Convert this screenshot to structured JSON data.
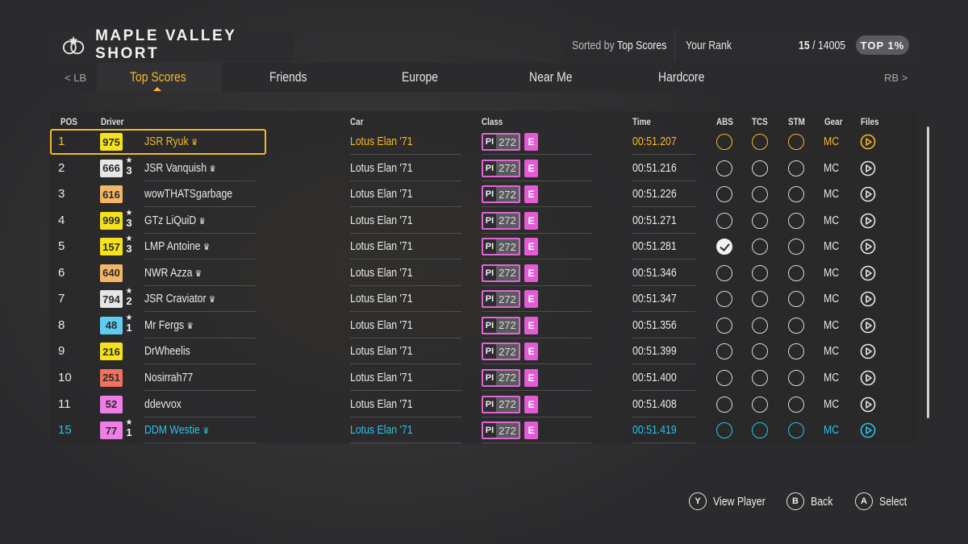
{
  "header": {
    "title": "MAPLE VALLEY SHORT",
    "sorted_prefix": "Sorted by",
    "sorted_value": "Top Scores",
    "your_rank_label": "Your Rank",
    "rank": "15",
    "rank_total": "/ 14005",
    "top_badge": "TOP 1%"
  },
  "tabs": {
    "lb": "< LB",
    "rb": "RB >",
    "items": [
      "Top Scores",
      "Friends",
      "Europe",
      "Near Me",
      "Hardcore"
    ],
    "active": "Top Scores"
  },
  "columns": {
    "pos": "POS",
    "driver": "Driver",
    "car": "Car",
    "class": "Class",
    "time": "Time",
    "abs": "ABS",
    "tcs": "TCS",
    "stm": "STM",
    "gear": "Gear",
    "files": "Files"
  },
  "colors": {
    "selected": "#f5b82c",
    "player": "#29c2e8",
    "class_e": "#e35cd6"
  },
  "rows": [
    {
      "pos": "1",
      "level": "975",
      "level_color": "#f6e21c",
      "stars": "",
      "driver": "JSR Ryuk",
      "crown": true,
      "car": "Lotus Elan '71",
      "pi_label": "PI",
      "pi": "272",
      "cls": "E",
      "time": "00:51.207",
      "abs": false,
      "tcs": false,
      "stm": false,
      "gear": "MC",
      "state": "selected"
    },
    {
      "pos": "2",
      "level": "666",
      "level_color": "#e6e6e6",
      "stars": "3",
      "driver": "JSR Vanquish",
      "crown": true,
      "car": "Lotus Elan '71",
      "pi_label": "PI",
      "pi": "272",
      "cls": "E",
      "time": "00:51.216",
      "abs": false,
      "tcs": false,
      "stm": false,
      "gear": "MC",
      "state": ""
    },
    {
      "pos": "3",
      "level": "616",
      "level_color": "#f3b667",
      "stars": "",
      "driver": "wowTHATSgarbage",
      "crown": false,
      "car": "Lotus Elan '71",
      "pi_label": "PI",
      "pi": "272",
      "cls": "E",
      "time": "00:51.226",
      "abs": false,
      "tcs": false,
      "stm": false,
      "gear": "MC",
      "state": ""
    },
    {
      "pos": "4",
      "level": "999",
      "level_color": "#f6e21c",
      "stars": "3",
      "driver": "GTz LiQuiD",
      "crown": true,
      "car": "Lotus Elan '71",
      "pi_label": "PI",
      "pi": "272",
      "cls": "E",
      "time": "00:51.271",
      "abs": false,
      "tcs": false,
      "stm": false,
      "gear": "MC",
      "state": ""
    },
    {
      "pos": "5",
      "level": "157",
      "level_color": "#f6e21c",
      "stars": "3",
      "driver": "LMP Antoine",
      "crown": true,
      "car": "Lotus Elan '71",
      "pi_label": "PI",
      "pi": "272",
      "cls": "E",
      "time": "00:51.281",
      "abs": true,
      "tcs": false,
      "stm": false,
      "gear": "MC",
      "state": ""
    },
    {
      "pos": "6",
      "level": "640",
      "level_color": "#f3b667",
      "stars": "",
      "driver": "NWR Azza",
      "crown": true,
      "car": "Lotus Elan '71",
      "pi_label": "PI",
      "pi": "272",
      "cls": "E",
      "time": "00:51.346",
      "abs": false,
      "tcs": false,
      "stm": false,
      "gear": "MC",
      "state": ""
    },
    {
      "pos": "7",
      "level": "794",
      "level_color": "#e6e6e6",
      "stars": "2",
      "driver": "JSR Craviator",
      "crown": true,
      "car": "Lotus Elan '71",
      "pi_label": "PI",
      "pi": "272",
      "cls": "E",
      "time": "00:51.347",
      "abs": false,
      "tcs": false,
      "stm": false,
      "gear": "MC",
      "state": ""
    },
    {
      "pos": "8",
      "level": "48",
      "level_color": "#5ecdf2",
      "stars": "1",
      "driver": "Mr Fergs",
      "crown": true,
      "car": "Lotus Elan '71",
      "pi_label": "PI",
      "pi": "272",
      "cls": "E",
      "time": "00:51.356",
      "abs": false,
      "tcs": false,
      "stm": false,
      "gear": "MC",
      "state": ""
    },
    {
      "pos": "9",
      "level": "216",
      "level_color": "#f6e21c",
      "stars": "",
      "driver": "DrWheelis",
      "crown": false,
      "car": "Lotus Elan '71",
      "pi_label": "PI",
      "pi": "272",
      "cls": "E",
      "time": "00:51.399",
      "abs": false,
      "tcs": false,
      "stm": false,
      "gear": "MC",
      "state": ""
    },
    {
      "pos": "10",
      "level": "251",
      "level_color": "#f0725f",
      "stars": "",
      "driver": "Nosirrah77",
      "crown": false,
      "car": "Lotus Elan '71",
      "pi_label": "PI",
      "pi": "272",
      "cls": "E",
      "time": "00:51.400",
      "abs": false,
      "tcs": false,
      "stm": false,
      "gear": "MC",
      "state": ""
    },
    {
      "pos": "11",
      "level": "52",
      "level_color": "#ee7ee6",
      "stars": "",
      "driver": "ddevvox",
      "crown": false,
      "car": "Lotus Elan '71",
      "pi_label": "PI",
      "pi": "272",
      "cls": "E",
      "time": "00:51.408",
      "abs": false,
      "tcs": false,
      "stm": false,
      "gear": "MC",
      "state": ""
    },
    {
      "pos": "15",
      "level": "77",
      "level_color": "#ee7ee6",
      "stars": "1",
      "driver": "DDM Westie",
      "crown": true,
      "car": "Lotus Elan '71",
      "pi_label": "PI",
      "pi": "272",
      "cls": "E",
      "time": "00:51.419",
      "abs": false,
      "tcs": false,
      "stm": false,
      "gear": "MC",
      "state": "player"
    }
  ],
  "footer": [
    {
      "key": "Y",
      "label": "View Player"
    },
    {
      "key": "B",
      "label": "Back"
    },
    {
      "key": "A",
      "label": "Select"
    }
  ]
}
